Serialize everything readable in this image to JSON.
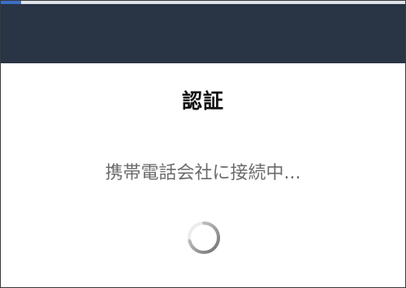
{
  "header": {
    "progress": 0.05
  },
  "dialog": {
    "title": "認証",
    "status_text": "携帯電話会社に接続中..."
  },
  "spinner": {
    "icon": "loading-spinner-icon"
  },
  "colors": {
    "header_bg": "#293444",
    "progress_fill": "#3b6fc4",
    "status_text": "#6b6b6b"
  }
}
